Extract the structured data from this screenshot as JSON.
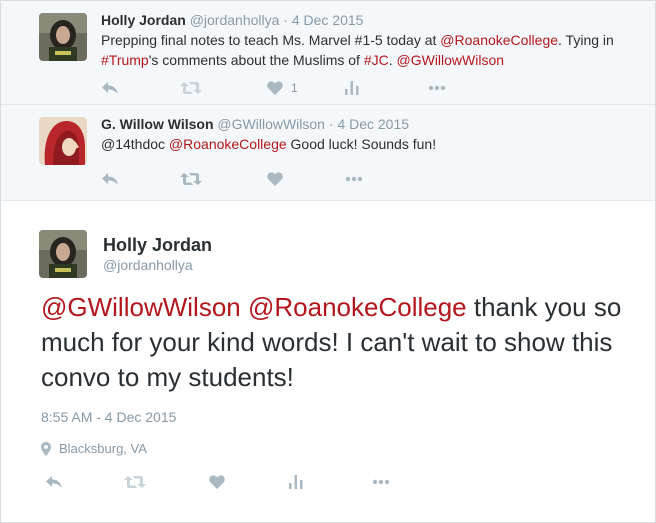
{
  "replies": [
    {
      "name": "Holly Jordan",
      "screen_name": "@jordanhollya",
      "dot": "·",
      "time": "4 Dec 2015",
      "text_parts": {
        "p1": "Prepping final notes to teach Ms. Marvel #1-5 today at ",
        "l1": "@RoanokeCollege",
        "p2": ". Tying in ",
        "l2": "#Trump",
        "p3": "'s comments about the Muslims of ",
        "l3": "#JC",
        "p4": ". ",
        "l4": "@GWillowWilson"
      },
      "like_count": "1"
    },
    {
      "name": "G. Willow Wilson",
      "screen_name": "@GWillowWilson",
      "dot": "·",
      "time": "4 Dec 2015",
      "text_parts": {
        "p1": "@14thdoc ",
        "l1": "@RoanokeCollege",
        "p2": " Good luck! Sounds fun!"
      }
    }
  ],
  "main": {
    "name": "Holly Jordan",
    "screen_name": "@jordanhollya",
    "text_parts": {
      "l1": "@GWillowWilson",
      "p1": " ",
      "l2": "@RoanokeCollege",
      "p2": " thank you so much for your kind words! I can't wait to show this convo to my students!"
    },
    "timestamp": "8:55 AM - 4 Dec 2015",
    "location": "Blacksburg, VA"
  },
  "icons": {
    "reply": "reply-arrow-icon",
    "retweet": "retweet-icon",
    "like": "heart-icon",
    "analytics": "bar-chart-icon",
    "more": "more-dots-icon",
    "location": "map-pin-icon"
  },
  "colors": {
    "link": "#b3171d",
    "muted": "#8899a6",
    "text": "#292f33",
    "reply_bg": "#f5f8fa"
  }
}
